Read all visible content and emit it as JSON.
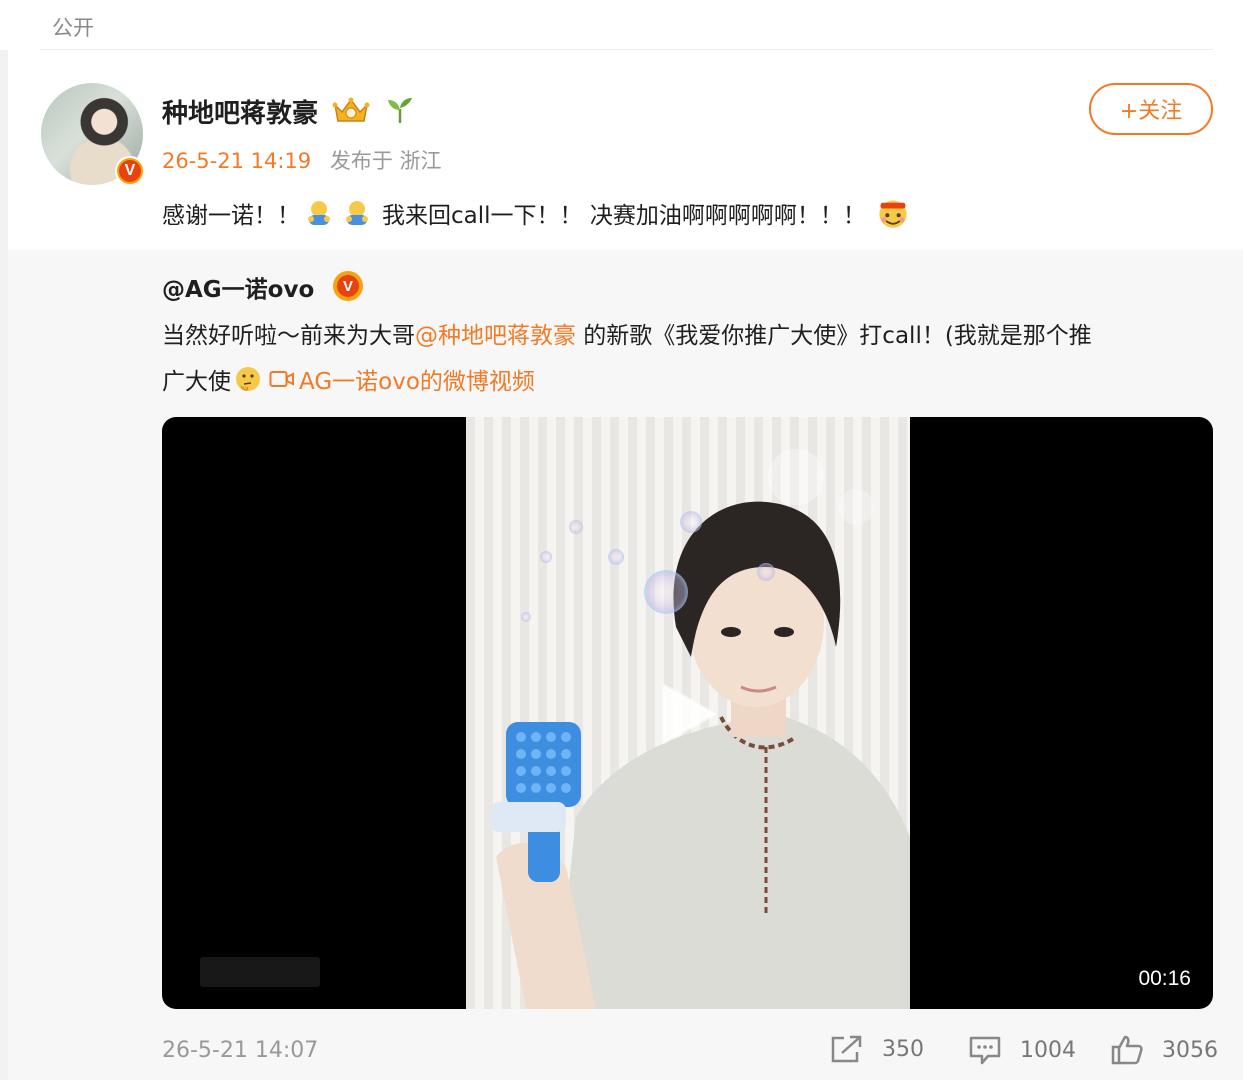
{
  "header": {
    "visibility_label": "公开"
  },
  "post": {
    "author": "种地吧蒋敦豪",
    "timestamp": "26-5-21 14:19",
    "source": "发布于 浙江",
    "follow_label": "+关注",
    "text_part1": "感谢一诺！！",
    "text_part2": "我来回call一下！！ 决赛加油啊啊啊啊啊！！！",
    "icons": [
      "crown-icon",
      "sprout-icon",
      "hug-emoji",
      "cheer-emoji",
      "verified-badge"
    ]
  },
  "repost": {
    "author": "@AG一诺ovo",
    "line1_text": "当然好听啦～前来为大哥",
    "line1_mention": "@种地吧蒋敦豪",
    "line1_rest": " 的新歌《我爱你推广大使》打call！(我就是那个推",
    "line2_text": "广大使",
    "video_link": "AG一诺ovo的微博视频",
    "video_duration": "00:16",
    "timestamp": "26-5-21 14:07",
    "stats": {
      "shares": "350",
      "comments": "1004",
      "likes": "3056"
    }
  },
  "colors": {
    "accent": "#f37a25",
    "text": "#1f1f1f",
    "muted": "#999999",
    "panel": "#f7f7f7"
  }
}
